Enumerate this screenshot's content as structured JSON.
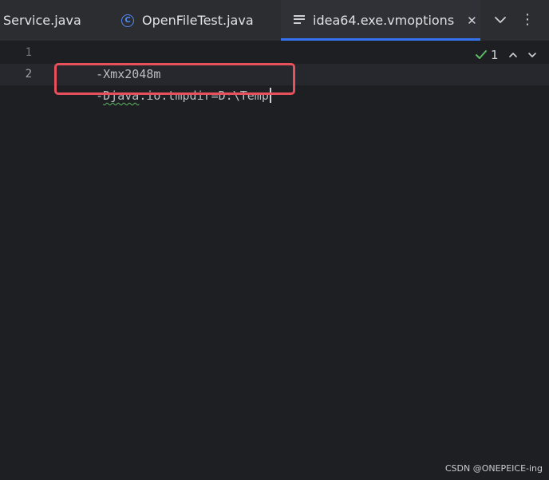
{
  "tabs": [
    {
      "label": "Service.java",
      "active": false
    },
    {
      "label": "OpenFileTest.java",
      "active": false,
      "icon": "class-icon"
    },
    {
      "label": "idea64.exe.vmoptions",
      "active": true,
      "icon": "text-file-icon"
    }
  ],
  "tab_close_glyph": "✕",
  "class_icon_letter": "C",
  "more_glyph": "⋮",
  "editor": {
    "lines": [
      {
        "number": "1",
        "text": "-Xmx2048m"
      },
      {
        "number": "2",
        "prefix": "-",
        "squiggle": "Djava",
        "rest": ".io.tmpdir=D:\\Temp"
      }
    ],
    "inspection_count": "1"
  },
  "watermark": "CSDN @ONEPEICE-ing",
  "colors": {
    "accent": "#3574f0",
    "highlight_box": "#e8505b",
    "ok_check": "#5fb865"
  }
}
